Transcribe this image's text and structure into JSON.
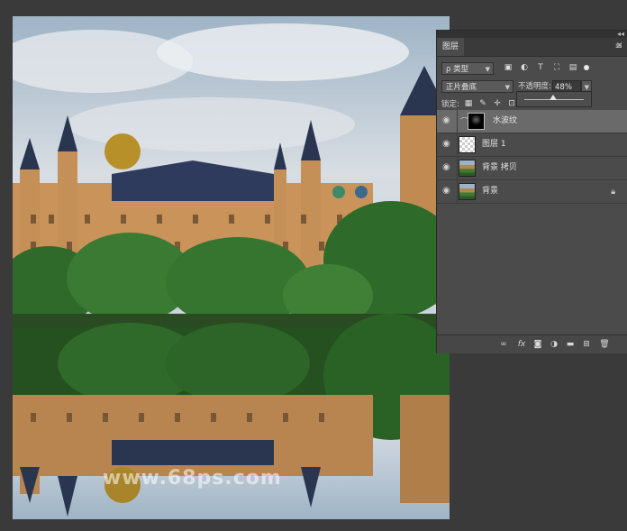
{
  "panel": {
    "tab_label": "图层",
    "collapse_glyph": "◂◂",
    "close_glyph": "✕",
    "menu_glyph": "≡"
  },
  "filter": {
    "kind_label": "类型",
    "kind_icon_glyph": "ρ"
  },
  "blend": {
    "mode": "正片叠底",
    "opacity_label": "不透明度:",
    "opacity_value": "48%",
    "opacity_fraction": 0.48
  },
  "lock": {
    "label": "锁定:"
  },
  "layers": [
    {
      "name": "水波纹",
      "type": "masked",
      "selected": true
    },
    {
      "name": "图层 1",
      "type": "transparent",
      "selected": false
    },
    {
      "name": "背景 拷贝",
      "type": "photo",
      "selected": false
    },
    {
      "name": "背景",
      "type": "photo",
      "selected": false,
      "locked": true
    }
  ],
  "canvas": {
    "watermark": "www.68ps.com"
  },
  "colors": {
    "panel_bg": "#4b4b4b",
    "selected_layer": "#6a6a6a",
    "workspace": "#3a3a3a"
  }
}
